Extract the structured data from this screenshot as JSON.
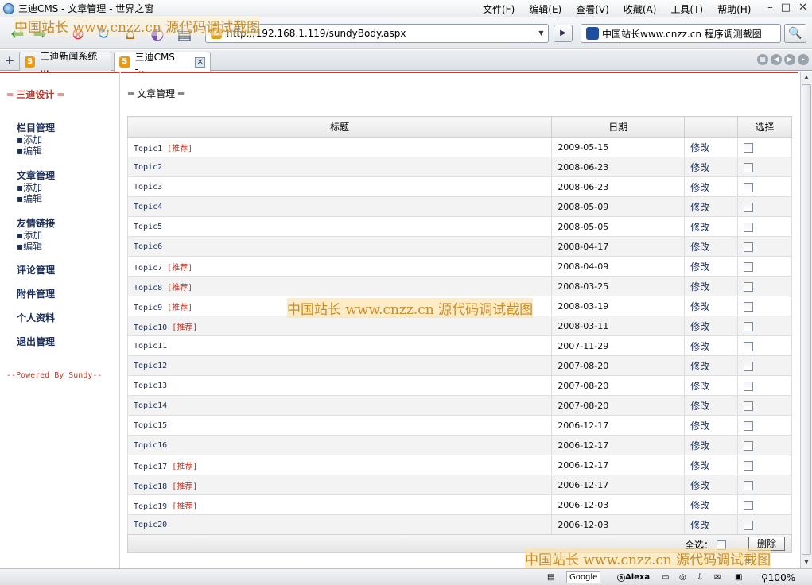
{
  "window": {
    "title": "三迪CMS - 文章管理 - 世界之窗",
    "menu": [
      "文件(F)",
      "编辑(E)",
      "查看(V)",
      "收藏(A)",
      "工具(T)",
      "帮助(H)"
    ]
  },
  "toolbar": {
    "url": "http://192.168.1.119/sundyBody.aspx",
    "search_text": "中国站长www.cnzz.cn 程序调测截图"
  },
  "tabs": [
    {
      "label": "三迪新闻系统 ..."
    },
    {
      "label": "三迪CMS -..."
    }
  ],
  "sidebar": {
    "title": "三迪设计",
    "groups": [
      {
        "head": "栏目管理",
        "items": [
          "添加",
          "编辑"
        ]
      },
      {
        "head": "文章管理",
        "items": [
          "添加",
          "编辑"
        ]
      },
      {
        "head": "友情链接",
        "items": [
          "添加",
          "编辑"
        ]
      },
      {
        "head": "评论管理",
        "items": []
      },
      {
        "head": "附件管理",
        "items": []
      },
      {
        "head": "个人资料",
        "items": []
      },
      {
        "head": "退出管理",
        "items": []
      }
    ],
    "powered": "--Powered By Sundy--"
  },
  "main": {
    "title": "文章管理",
    "columns": [
      "标题",
      "日期",
      "",
      "选择"
    ],
    "recommend_tag": "[推荐]",
    "edit_label": "修改",
    "rows": [
      {
        "title": "Topic1",
        "rec": true,
        "date": "2009-05-15"
      },
      {
        "title": "Topic2",
        "rec": false,
        "date": "2008-06-23"
      },
      {
        "title": "Topic3",
        "rec": false,
        "date": "2008-06-23"
      },
      {
        "title": "Topic4",
        "rec": false,
        "date": "2008-05-09"
      },
      {
        "title": "Topic5",
        "rec": false,
        "date": "2008-05-05"
      },
      {
        "title": "Topic6",
        "rec": false,
        "date": "2008-04-17"
      },
      {
        "title": "Topic7",
        "rec": true,
        "date": "2008-04-09"
      },
      {
        "title": "Topic8",
        "rec": true,
        "date": "2008-03-25"
      },
      {
        "title": "Topic9",
        "rec": true,
        "date": "2008-03-19"
      },
      {
        "title": "Topic10",
        "rec": true,
        "date": "2008-03-11"
      },
      {
        "title": "Topic11",
        "rec": false,
        "date": "2007-11-29"
      },
      {
        "title": "Topic12",
        "rec": false,
        "date": "2007-08-20"
      },
      {
        "title": "Topic13",
        "rec": false,
        "date": "2007-08-20"
      },
      {
        "title": "Topic14",
        "rec": false,
        "date": "2007-08-20"
      },
      {
        "title": "Topic15",
        "rec": false,
        "date": "2006-12-17"
      },
      {
        "title": "Topic16",
        "rec": false,
        "date": "2006-12-17"
      },
      {
        "title": "Topic17",
        "rec": true,
        "date": "2006-12-17"
      },
      {
        "title": "Topic18",
        "rec": true,
        "date": "2006-12-17"
      },
      {
        "title": "Topic19",
        "rec": true,
        "date": "2006-12-03"
      },
      {
        "title": "Topic20",
        "rec": false,
        "date": "2006-12-03"
      }
    ],
    "select_all_label": "全选：",
    "delete_label": "删除"
  },
  "watermark": "中国站长 www.cnzz.cn 源代码调试截图",
  "watermark_top": "中国站长 www.cnzz.cn 源代码调试截图",
  "status": {
    "google": "Google",
    "alexa": "Alexa",
    "zoom": "100%"
  }
}
